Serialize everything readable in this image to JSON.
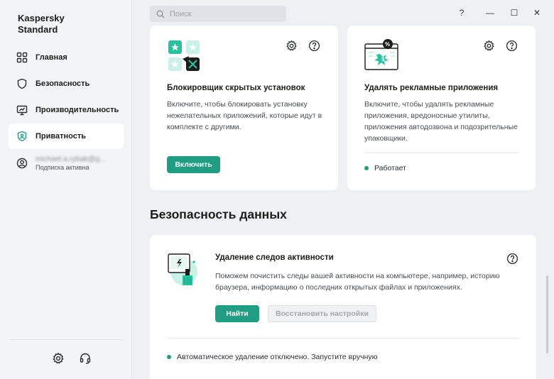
{
  "app": {
    "title": "Kaspersky Standard"
  },
  "search": {
    "placeholder": "Поиск"
  },
  "window": {
    "help": "?",
    "minimize": "—",
    "maximize": "☐",
    "close": "✕"
  },
  "sidebar": {
    "items": [
      {
        "label": "Главная",
        "icon": "home-icon"
      },
      {
        "label": "Безопасность",
        "icon": "shield-icon"
      },
      {
        "label": "Производительность",
        "icon": "monitor-icon"
      },
      {
        "label": "Приватность",
        "icon": "privacy-shield-icon",
        "active": true
      }
    ],
    "account": {
      "email": "michael.a.rybak@g...",
      "status": "Подписка активна"
    }
  },
  "cards": {
    "hidden_install": {
      "title": "Блокировщик скрытых установок",
      "description": "Включите, чтобы блокировать установку нежелательных приложений, которые идут в комплекте с другими.",
      "button": "Включить"
    },
    "adware": {
      "title": "Удалять рекламные приложения",
      "description": "Включите, чтобы удалять рекламные приложения, вредоносные утилиты, приложения автодозвона и подозрительные упаковщики.",
      "status": "Работает"
    }
  },
  "data_security": {
    "section_title": "Безопасность данных",
    "activity": {
      "title": "Удаление следов активности",
      "description": "Поможем почистить следы вашей активности на компьютере, например, историю браузера, информацию о последних открытых файлах и приложениях.",
      "find_button": "Найти",
      "restore_button": "Восстановить настройки",
      "status": "Автоматическое удаление отключено. Запустите вручную"
    }
  },
  "colors": {
    "accent": "#1f9e83",
    "status_green": "#1f9e83"
  }
}
